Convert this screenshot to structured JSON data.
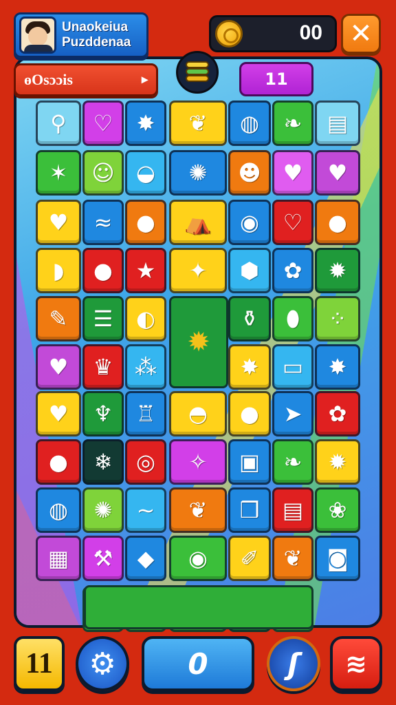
{
  "player": {
    "name_line1": "Unaokeiua",
    "name_line2": "Puzddenaa",
    "avatar_icon": "player-avatar"
  },
  "coins": {
    "value": "00",
    "icon": "coin-icon"
  },
  "close_button": {
    "label": "✕"
  },
  "level": {
    "label": "ɵOsɔɔis",
    "arrow": "▸"
  },
  "moves": {
    "value": "11"
  },
  "stack_icon": "layered-stack-icon",
  "grid": {
    "tiles": [
      {
        "row": 0,
        "col": 0,
        "color": "#7fd6f2",
        "icon": "pin-icon",
        "glyph": "⚲"
      },
      {
        "row": 0,
        "col": 1,
        "color": "#d23fe8",
        "icon": "heart-outline-icon",
        "glyph": "♡"
      },
      {
        "row": 0,
        "col": 2,
        "color": "#1f88e0",
        "icon": "maple-leaf-icon",
        "glyph": "✸"
      },
      {
        "row": 0,
        "col": 3,
        "color": "#ffd21a",
        "icon": "shell-icon",
        "glyph": "❦"
      },
      {
        "row": 0,
        "col": 4,
        "color": "#1f88e0",
        "icon": "drum-icon",
        "glyph": "◍"
      },
      {
        "row": 0,
        "col": 5,
        "color": "#3bbf3a",
        "icon": "leaf-icon",
        "glyph": "❧"
      },
      {
        "row": 0,
        "col": 6,
        "color": "#7fd6f2",
        "icon": "jar-icon",
        "glyph": "▤"
      },
      {
        "row": 1,
        "col": 0,
        "color": "#3bbf3a",
        "icon": "flame-leaf-icon",
        "glyph": "✶"
      },
      {
        "row": 1,
        "col": 1,
        "color": "#7fd33a",
        "icon": "smiley-icon",
        "glyph": "☺"
      },
      {
        "row": 1,
        "col": 2,
        "color": "#35b6f0",
        "icon": "bowl-icon",
        "glyph": "◒"
      },
      {
        "row": 1,
        "col": 3,
        "color": "#1f88e0",
        "icon": "sun-icon",
        "glyph": "✺"
      },
      {
        "row": 1,
        "col": 4,
        "color": "#f07a10",
        "icon": "smiley-icon",
        "glyph": "☻"
      },
      {
        "row": 1,
        "col": 5,
        "color": "#e05cf0",
        "icon": "heart-icon",
        "glyph": "♥"
      },
      {
        "row": 1,
        "col": 6,
        "color": "#c24ad8",
        "icon": "heart-icon",
        "glyph": "♥"
      },
      {
        "row": 2,
        "col": 0,
        "color": "#ffd21a",
        "icon": "heart-icon",
        "glyph": "♥"
      },
      {
        "row": 2,
        "col": 1,
        "color": "#1f88e0",
        "icon": "wave-icon",
        "glyph": "≈"
      },
      {
        "row": 2,
        "col": 2,
        "color": "#f07a10",
        "icon": "apple-icon",
        "glyph": "●"
      },
      {
        "row": 2,
        "col": 3,
        "color": "#ffd21a",
        "icon": "tent-icon",
        "glyph": "⛺"
      },
      {
        "row": 2,
        "col": 4,
        "color": "#1f88e0",
        "icon": "eye-icon",
        "glyph": "◉"
      },
      {
        "row": 2,
        "col": 5,
        "color": "#e02020",
        "icon": "heart-outline-icon",
        "glyph": "♡"
      },
      {
        "row": 2,
        "col": 6,
        "color": "#f07a10",
        "icon": "lemon-icon",
        "glyph": "●"
      },
      {
        "row": 3,
        "col": 0,
        "color": "#ffd21a",
        "icon": "helmet-icon",
        "glyph": "◗"
      },
      {
        "row": 3,
        "col": 1,
        "color": "#e02020",
        "icon": "onion-icon",
        "glyph": "●"
      },
      {
        "row": 3,
        "col": 2,
        "color": "#e02020",
        "icon": "star-icon",
        "glyph": "★"
      },
      {
        "row": 3,
        "col": 3,
        "color": "#ffd21a",
        "icon": "candy-icon",
        "glyph": "✦"
      },
      {
        "row": 3,
        "col": 4,
        "color": "#35b6f0",
        "icon": "hexagon-icon",
        "glyph": "⬢"
      },
      {
        "row": 3,
        "col": 5,
        "color": "#1f88e0",
        "icon": "flower-icon",
        "glyph": "✿"
      },
      {
        "row": 3,
        "col": 6,
        "color": "#1f9a3a",
        "icon": "gear-icon",
        "glyph": "✹"
      },
      {
        "row": 4,
        "col": 0,
        "color": "#f07a10",
        "icon": "popsicle-icon",
        "glyph": "✎"
      },
      {
        "row": 4,
        "col": 1,
        "color": "#1f9a3a",
        "icon": "burger-icon",
        "glyph": "☰"
      },
      {
        "row": 4,
        "col": 2,
        "color": "#ffd21a",
        "icon": "orange-icon",
        "glyph": "◐"
      },
      {
        "row": 4,
        "col": 4,
        "color": "#1f9a3a",
        "icon": "potion-icon",
        "glyph": "⚱"
      },
      {
        "row": 4,
        "col": 5,
        "color": "#3bbf3a",
        "icon": "pickle-icon",
        "glyph": "⬮"
      },
      {
        "row": 4,
        "col": 6,
        "color": "#7fd33a",
        "icon": "dice-icon",
        "glyph": "⁘"
      },
      {
        "row": 5,
        "col": 0,
        "color": "#c24ad8",
        "icon": "heart-icon",
        "glyph": "♥"
      },
      {
        "row": 5,
        "col": 1,
        "color": "#e02020",
        "icon": "crown-icon",
        "glyph": "♛"
      },
      {
        "row": 5,
        "col": 2,
        "color": "#35b6f0",
        "icon": "grapes-icon",
        "glyph": "⁂"
      },
      {
        "row": 5,
        "col": 4,
        "color": "#ffd21a",
        "icon": "burst-icon",
        "glyph": "✸"
      },
      {
        "row": 5,
        "col": 5,
        "color": "#35b6f0",
        "icon": "ruler-icon",
        "glyph": "▭"
      },
      {
        "row": 5,
        "col": 6,
        "color": "#1f88e0",
        "icon": "maple-leaf-icon",
        "glyph": "✸"
      },
      {
        "row": 6,
        "col": 0,
        "color": "#ffd21a",
        "icon": "heart-icon",
        "glyph": "♥"
      },
      {
        "row": 6,
        "col": 1,
        "color": "#1f9a3a",
        "icon": "cactus-icon",
        "glyph": "♆"
      },
      {
        "row": 6,
        "col": 2,
        "color": "#1f88e0",
        "icon": "bottle-icon",
        "glyph": "♖"
      },
      {
        "row": 6,
        "col": 3,
        "color": "#ffd21a",
        "icon": "melon-icon",
        "glyph": "◓"
      },
      {
        "row": 6,
        "col": 4,
        "color": "#ffd21a",
        "icon": "pepper-icon",
        "glyph": "●"
      },
      {
        "row": 6,
        "col": 5,
        "color": "#1f88e0",
        "icon": "arrow-icon",
        "glyph": "➤"
      },
      {
        "row": 6,
        "col": 6,
        "color": "#e02020",
        "icon": "cookie-icon",
        "glyph": "✿"
      },
      {
        "row": 7,
        "col": 0,
        "color": "#e02020",
        "icon": "onion-icon",
        "glyph": "●"
      },
      {
        "row": 7,
        "col": 1,
        "color": "#123a33",
        "icon": "snowflake-icon",
        "glyph": "❄"
      },
      {
        "row": 7,
        "col": 2,
        "color": "#e02020",
        "icon": "ring-icon",
        "glyph": "◎"
      },
      {
        "row": 7,
        "col": 3,
        "color": "#d23fe8",
        "icon": "syringe-icon",
        "glyph": "✧"
      },
      {
        "row": 7,
        "col": 4,
        "color": "#1f88e0",
        "icon": "box-icon",
        "glyph": "▣"
      },
      {
        "row": 7,
        "col": 5,
        "color": "#3bbf3a",
        "icon": "leaf-icon",
        "glyph": "❧"
      },
      {
        "row": 7,
        "col": 6,
        "color": "#ffd21a",
        "icon": "flame-icon",
        "glyph": "✹"
      },
      {
        "row": 8,
        "col": 0,
        "color": "#1f88e0",
        "icon": "drum-icon",
        "glyph": "◍"
      },
      {
        "row": 8,
        "col": 1,
        "color": "#7fd33a",
        "icon": "sun-icon",
        "glyph": "✺"
      },
      {
        "row": 8,
        "col": 2,
        "color": "#35b6f0",
        "icon": "wave-icon",
        "glyph": "∼"
      },
      {
        "row": 8,
        "col": 3,
        "color": "#f07a10",
        "icon": "shell-icon",
        "glyph": "❦"
      },
      {
        "row": 8,
        "col": 4,
        "color": "#1f88e0",
        "icon": "cube-stack-icon",
        "glyph": "❒"
      },
      {
        "row": 8,
        "col": 5,
        "color": "#e02020",
        "icon": "sign-icon",
        "glyph": "▤"
      },
      {
        "row": 8,
        "col": 6,
        "color": "#3bbf3a",
        "icon": "rose-icon",
        "glyph": "❀"
      },
      {
        "row": 9,
        "col": 0,
        "color": "#c24ad8",
        "icon": "crate-icon",
        "glyph": "▦"
      },
      {
        "row": 9,
        "col": 1,
        "color": "#d23fe8",
        "icon": "hammer-icon",
        "glyph": "⚒"
      },
      {
        "row": 9,
        "col": 2,
        "color": "#1f88e0",
        "icon": "diamond-icon",
        "glyph": "◆"
      },
      {
        "row": 9,
        "col": 3,
        "color": "#3bbf3a",
        "icon": "eye-icon",
        "glyph": "◉"
      },
      {
        "row": 9,
        "col": 4,
        "color": "#ffd21a",
        "icon": "rocket-icon",
        "glyph": "✐"
      },
      {
        "row": 9,
        "col": 5,
        "color": "#f07a10",
        "icon": "leaf-icon",
        "glyph": "❦"
      },
      {
        "row": 9,
        "col": 6,
        "color": "#1f88e0",
        "icon": "camera-icon",
        "glyph": "◙"
      },
      {
        "row": 10,
        "col": 1,
        "color": "#3bbf3a",
        "icon": "heart-icon",
        "glyph": "♥"
      },
      {
        "row": 10,
        "col": 2,
        "color": "#3bbf3a",
        "icon": "apple-icon",
        "glyph": "●"
      },
      {
        "row": 10,
        "col": 3,
        "color": "#3bbf3a",
        "icon": "burst-icon",
        "glyph": "✸"
      },
      {
        "row": 10,
        "col": 4,
        "color": "#1f9a3a",
        "icon": "fleur-icon",
        "glyph": "⚜"
      },
      {
        "row": 10,
        "col": 5,
        "color": "#3bbf3a",
        "icon": "heart-icon",
        "glyph": "♥"
      }
    ]
  },
  "big_tile": {
    "icon": "gear-cluster-icon",
    "glyph": "✹"
  },
  "bottom_bar": {
    "level_button": {
      "label": "11"
    },
    "settings_button": {
      "icon": "gear-icon",
      "glyph": "⚙"
    },
    "play_button": {
      "label": "0"
    },
    "boost_button": {
      "label": "ʃ"
    },
    "shop_button": {
      "icon": "wifi-icon",
      "glyph": "≋"
    }
  }
}
